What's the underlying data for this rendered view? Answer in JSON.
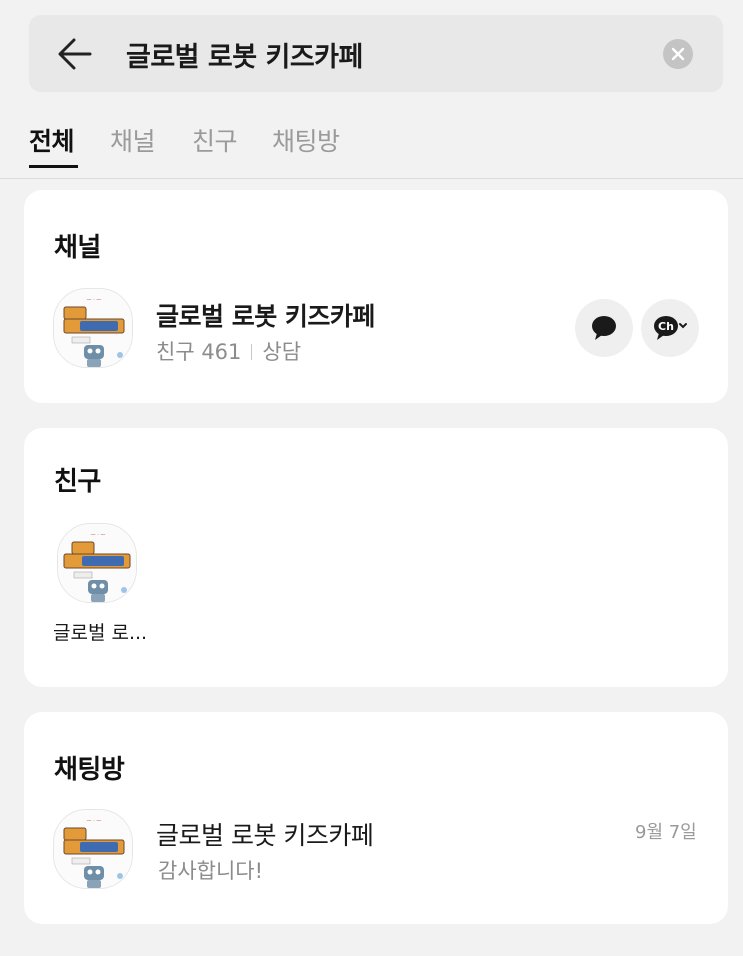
{
  "search": {
    "query": "글로벌 로봇 키즈카페"
  },
  "tabs": [
    {
      "label": "전체"
    },
    {
      "label": "채널"
    },
    {
      "label": "친구"
    },
    {
      "label": "채팅방"
    }
  ],
  "channel_section": {
    "title": "채널",
    "item": {
      "name": "글로벌 로봇 키즈카페",
      "friends": "친구 461",
      "consult": "상담"
    }
  },
  "friend_section": {
    "title": "친구",
    "item": {
      "name": "글로벌 로..."
    }
  },
  "chat_section": {
    "title": "채팅방",
    "item": {
      "name": "글로벌 로봇 키즈카페",
      "message": "감사합니다!",
      "date": "9월 7일"
    }
  },
  "icons": {
    "back": "arrow-left-icon",
    "clear": "clear-x-icon",
    "chat": "chat-bubble-icon",
    "channel": "channel-ch-icon"
  },
  "colors": {
    "accent": "#111111",
    "muted": "#8c8c8c",
    "background": "#f2f2f2"
  }
}
